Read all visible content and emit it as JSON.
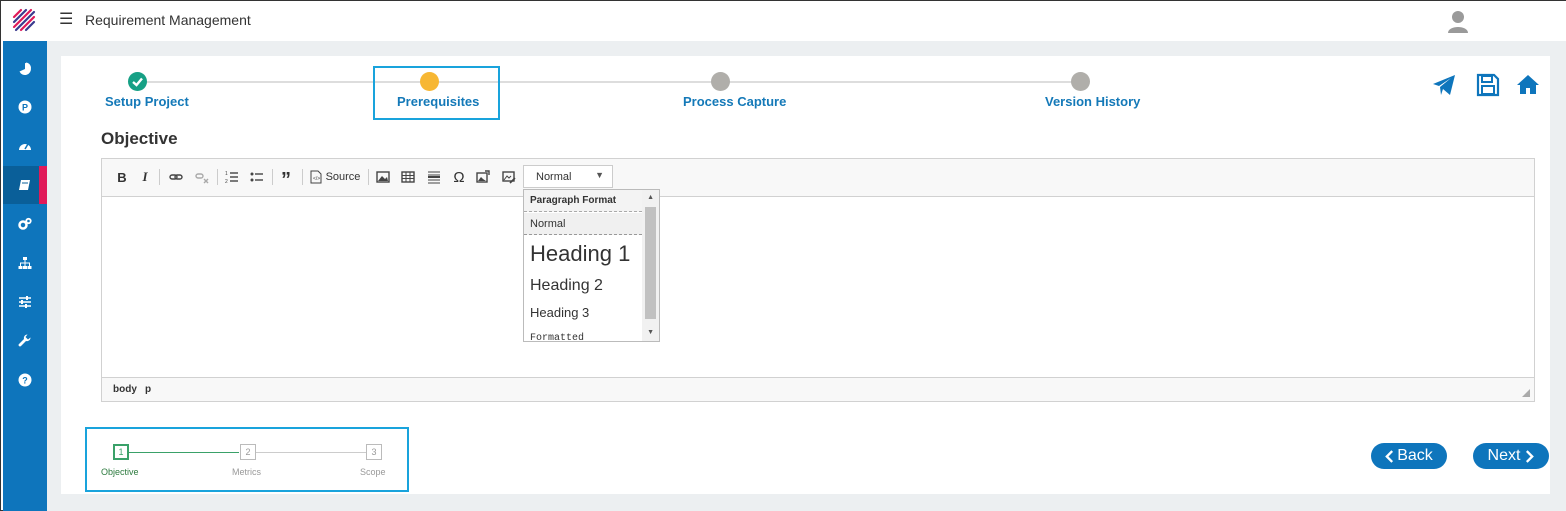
{
  "app": {
    "title": "Requirement Management"
  },
  "sidebar": {
    "items": [
      {
        "icon": "pie-chart-icon"
      },
      {
        "icon": "p-circle-icon"
      },
      {
        "icon": "dashboard-icon"
      },
      {
        "icon": "book-icon",
        "active": true
      },
      {
        "icon": "gears-icon"
      },
      {
        "icon": "sitemap-icon"
      },
      {
        "icon": "sliders-icon"
      },
      {
        "icon": "wrench-icon"
      },
      {
        "icon": "help-icon"
      }
    ]
  },
  "stepper": {
    "steps": [
      {
        "label": "Setup Project",
        "status": "completed"
      },
      {
        "label": "Prerequisites",
        "status": "current"
      },
      {
        "label": "Process Capture",
        "status": "pending"
      },
      {
        "label": "Version History",
        "status": "pending"
      }
    ]
  },
  "section": {
    "title": "Objective"
  },
  "editor": {
    "toolbar": {
      "bold": "B",
      "italic": "I",
      "quote": "”",
      "source": "Source",
      "omega": "Ω",
      "format_value": "Normal"
    },
    "status_path": [
      "body",
      "p"
    ]
  },
  "format_dropdown": {
    "header": "Paragraph Format",
    "options": [
      "Normal",
      "Heading 1",
      "Heading 2",
      "Heading 3",
      "Formatted"
    ]
  },
  "sub_stepper": {
    "steps": [
      {
        "number": "1",
        "label": "Objective",
        "active": true
      },
      {
        "number": "2",
        "label": "Metrics"
      },
      {
        "number": "3",
        "label": "Scope"
      }
    ]
  },
  "buttons": {
    "back": "Back",
    "next": "Next"
  },
  "colors": {
    "primary": "#0e75bc",
    "highlight_box": "#19a3dc",
    "step_done": "#16a085",
    "step_current": "#f7b733",
    "step_pending": "#b0aeaa",
    "active_marker": "#e01a59",
    "sub_active": "#3aa169"
  }
}
